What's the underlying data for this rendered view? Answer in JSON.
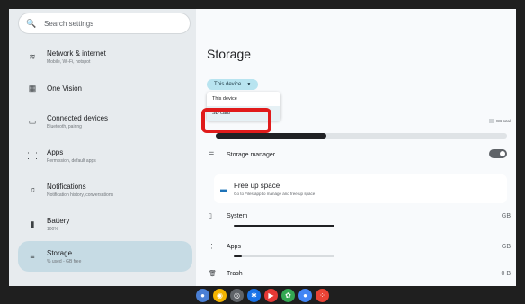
{
  "search": {
    "placeholder": "Search settings",
    "icon": "search-icon"
  },
  "sidebar": {
    "items": [
      {
        "title": "Network & internet",
        "subtitle": "Mobile, Wi-Fi, hotspot",
        "icon": "wifi-icon"
      },
      {
        "title": "One Vision",
        "subtitle": "",
        "icon": "grid-icon"
      },
      {
        "title": "Connected devices",
        "subtitle": "Bluetooth, pairing",
        "icon": "devices-icon"
      },
      {
        "title": "Apps",
        "subtitle": "Permission, default apps",
        "icon": "apps-grid-icon"
      },
      {
        "title": "Notifications",
        "subtitle": "Notification history, conversations",
        "icon": "bell-icon"
      },
      {
        "title": "Battery",
        "subtitle": "100%",
        "icon": "battery-icon"
      },
      {
        "title": "Storage",
        "subtitle": "% used - GB free",
        "icon": "storage-icon"
      }
    ],
    "selected_index": 6
  },
  "main": {
    "title": "Storage",
    "device_dropdown": {
      "selected": "This device"
    },
    "dropdown_menu": {
      "options": [
        "This device",
        "SD card"
      ],
      "highlighted": "SD card"
    },
    "total_label": "GB total",
    "storage_manager": {
      "label": "Storage manager",
      "enabled": true
    },
    "free_up": {
      "title": "Free up space",
      "subtitle": "Go to Files app to manage and free up space"
    },
    "categories": [
      {
        "label": "System",
        "value": "GB",
        "fraction": 1.0
      },
      {
        "label": "Apps",
        "value": "GB",
        "fraction": 0.08
      },
      {
        "label": "Trash",
        "value": "0 B",
        "fraction": 0.0
      }
    ],
    "usage_fraction": 0.38
  },
  "annotation": {
    "color": "#e01b1b"
  },
  "taskbar": {
    "apps": [
      "chrome-icon",
      "camera-icon",
      "settings-icon",
      "play-store-icon",
      "photos-icon",
      "assistant-icon",
      "google-apps-icon"
    ]
  }
}
